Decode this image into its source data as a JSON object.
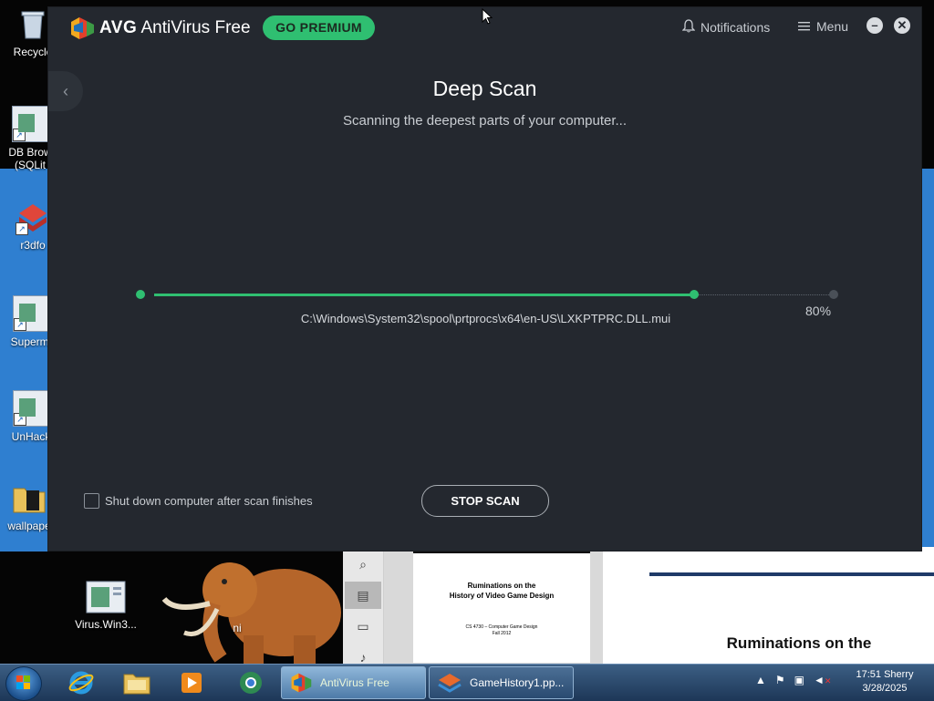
{
  "desktop": {
    "icons": [
      {
        "label": "Recycle"
      },
      {
        "label": "DB Brow"
      },
      {
        "label": "(SQLit"
      },
      {
        "label": "r3dfo"
      },
      {
        "label": "Supermi"
      },
      {
        "label": "UnHack"
      },
      {
        "label": "wallpape"
      },
      {
        "label": "Virus.Win3..."
      },
      {
        "label": "ni"
      }
    ]
  },
  "background_doc": {
    "thumb_title_line1": "Ruminations on the",
    "thumb_title_line2": "History of Video Game Design",
    "thumb_sub_line1": "CS 4730 – Computer Game Design",
    "thumb_sub_line2": "Fall 2012",
    "page_title": "Ruminations on the"
  },
  "avg": {
    "brand": "AVG",
    "product": "AntiVirus Free",
    "go_premium": "GO PREMIUM",
    "notifications": "Notifications",
    "menu": "Menu",
    "back_icon": "chevron-left-icon",
    "scan_title": "Deep Scan",
    "scan_subtitle": "Scanning the deepest parts of your computer...",
    "current_file": "C:\\Windows\\System32\\spool\\prtprocs\\x64\\en-US\\LXKPTPRC.DLL.mui",
    "progress": 0.8,
    "progress_label": "80%",
    "shutdown_label": "Shut down computer after scan finishes",
    "shutdown_checked": false,
    "stop_button": "STOP SCAN",
    "accent_color": "#2fbf71"
  },
  "taskbar": {
    "tasks": [
      {
        "label": "AntiVirus Free",
        "active": true
      },
      {
        "label": "GameHistory1.pp...",
        "active": false
      }
    ],
    "user": "Sherry",
    "time": "17:51",
    "date": "3/28/2025"
  }
}
